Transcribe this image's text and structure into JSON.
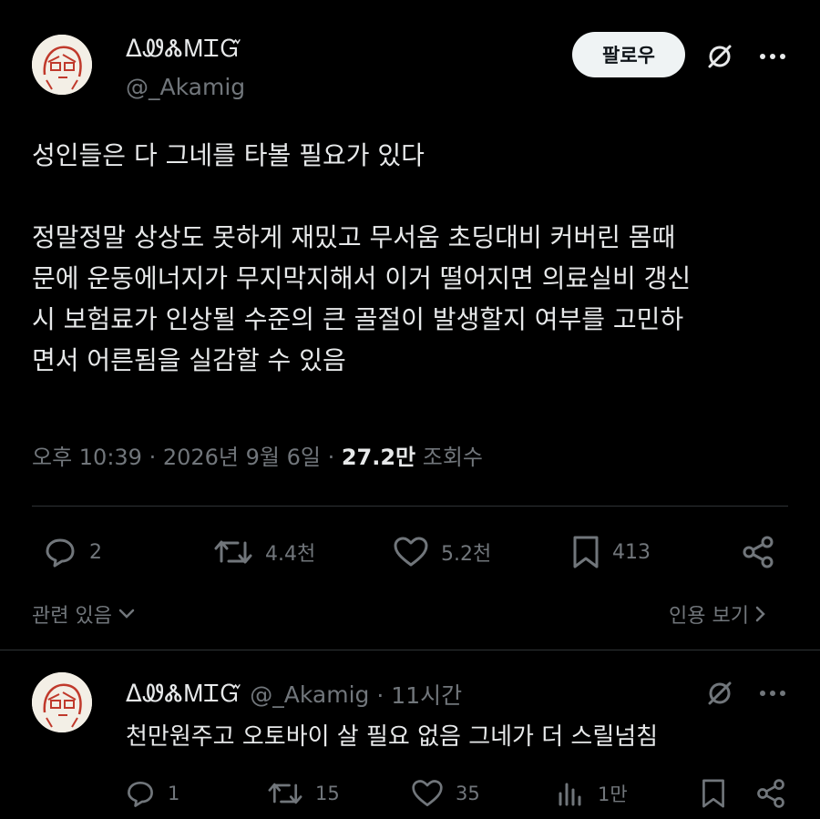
{
  "author": {
    "display_name": "ᐃᏪᏜᎷᏆᏳ",
    "handle": "@_Akamig"
  },
  "header": {
    "follow_label": "팔로우",
    "grok_icon": "slash-circle-icon",
    "more_icon": "more-horizontal-icon"
  },
  "tweet": {
    "lines": [
      "성인들은 다 그네를 타볼 필요가 있다",
      "",
      "정말정말 상상도 못하게 재밌고 무서움 초딩대비 커버린 몸때",
      "문에 운동에너지가 무지막지해서 이거 떨어지면 의료실비 갱신",
      "시 보험료가 인상될 수준의 큰 골절이 발생할지 여부를 고민하",
      "면서 어른됨을 실감할 수 있음"
    ],
    "time": "오후 10:39 · 2026년 9월 6일 · ",
    "views_count": "27.2만",
    "views_label": " 조회수"
  },
  "actions": {
    "replies": "2",
    "retweets": "4.4천",
    "likes": "5.2천",
    "bookmarks": "413"
  },
  "footer": {
    "related": "관련 있음",
    "quotes": "인용 보기"
  },
  "reply": {
    "display_name": "ᐃᏪᏜᎷᏆᏳ",
    "handle": "@_Akamig",
    "time": "· 11시간",
    "text": "천만원주고 오토바이 살 필요 없음 그네가 더 스릴넘침",
    "replies": "1",
    "retweets": "15",
    "likes": "35",
    "views": "1만"
  },
  "colors": {
    "background": "#000000",
    "text": "#e7e9ea",
    "muted": "#71767b",
    "divider": "#2f3336",
    "avatar_line": "#c0392b"
  }
}
